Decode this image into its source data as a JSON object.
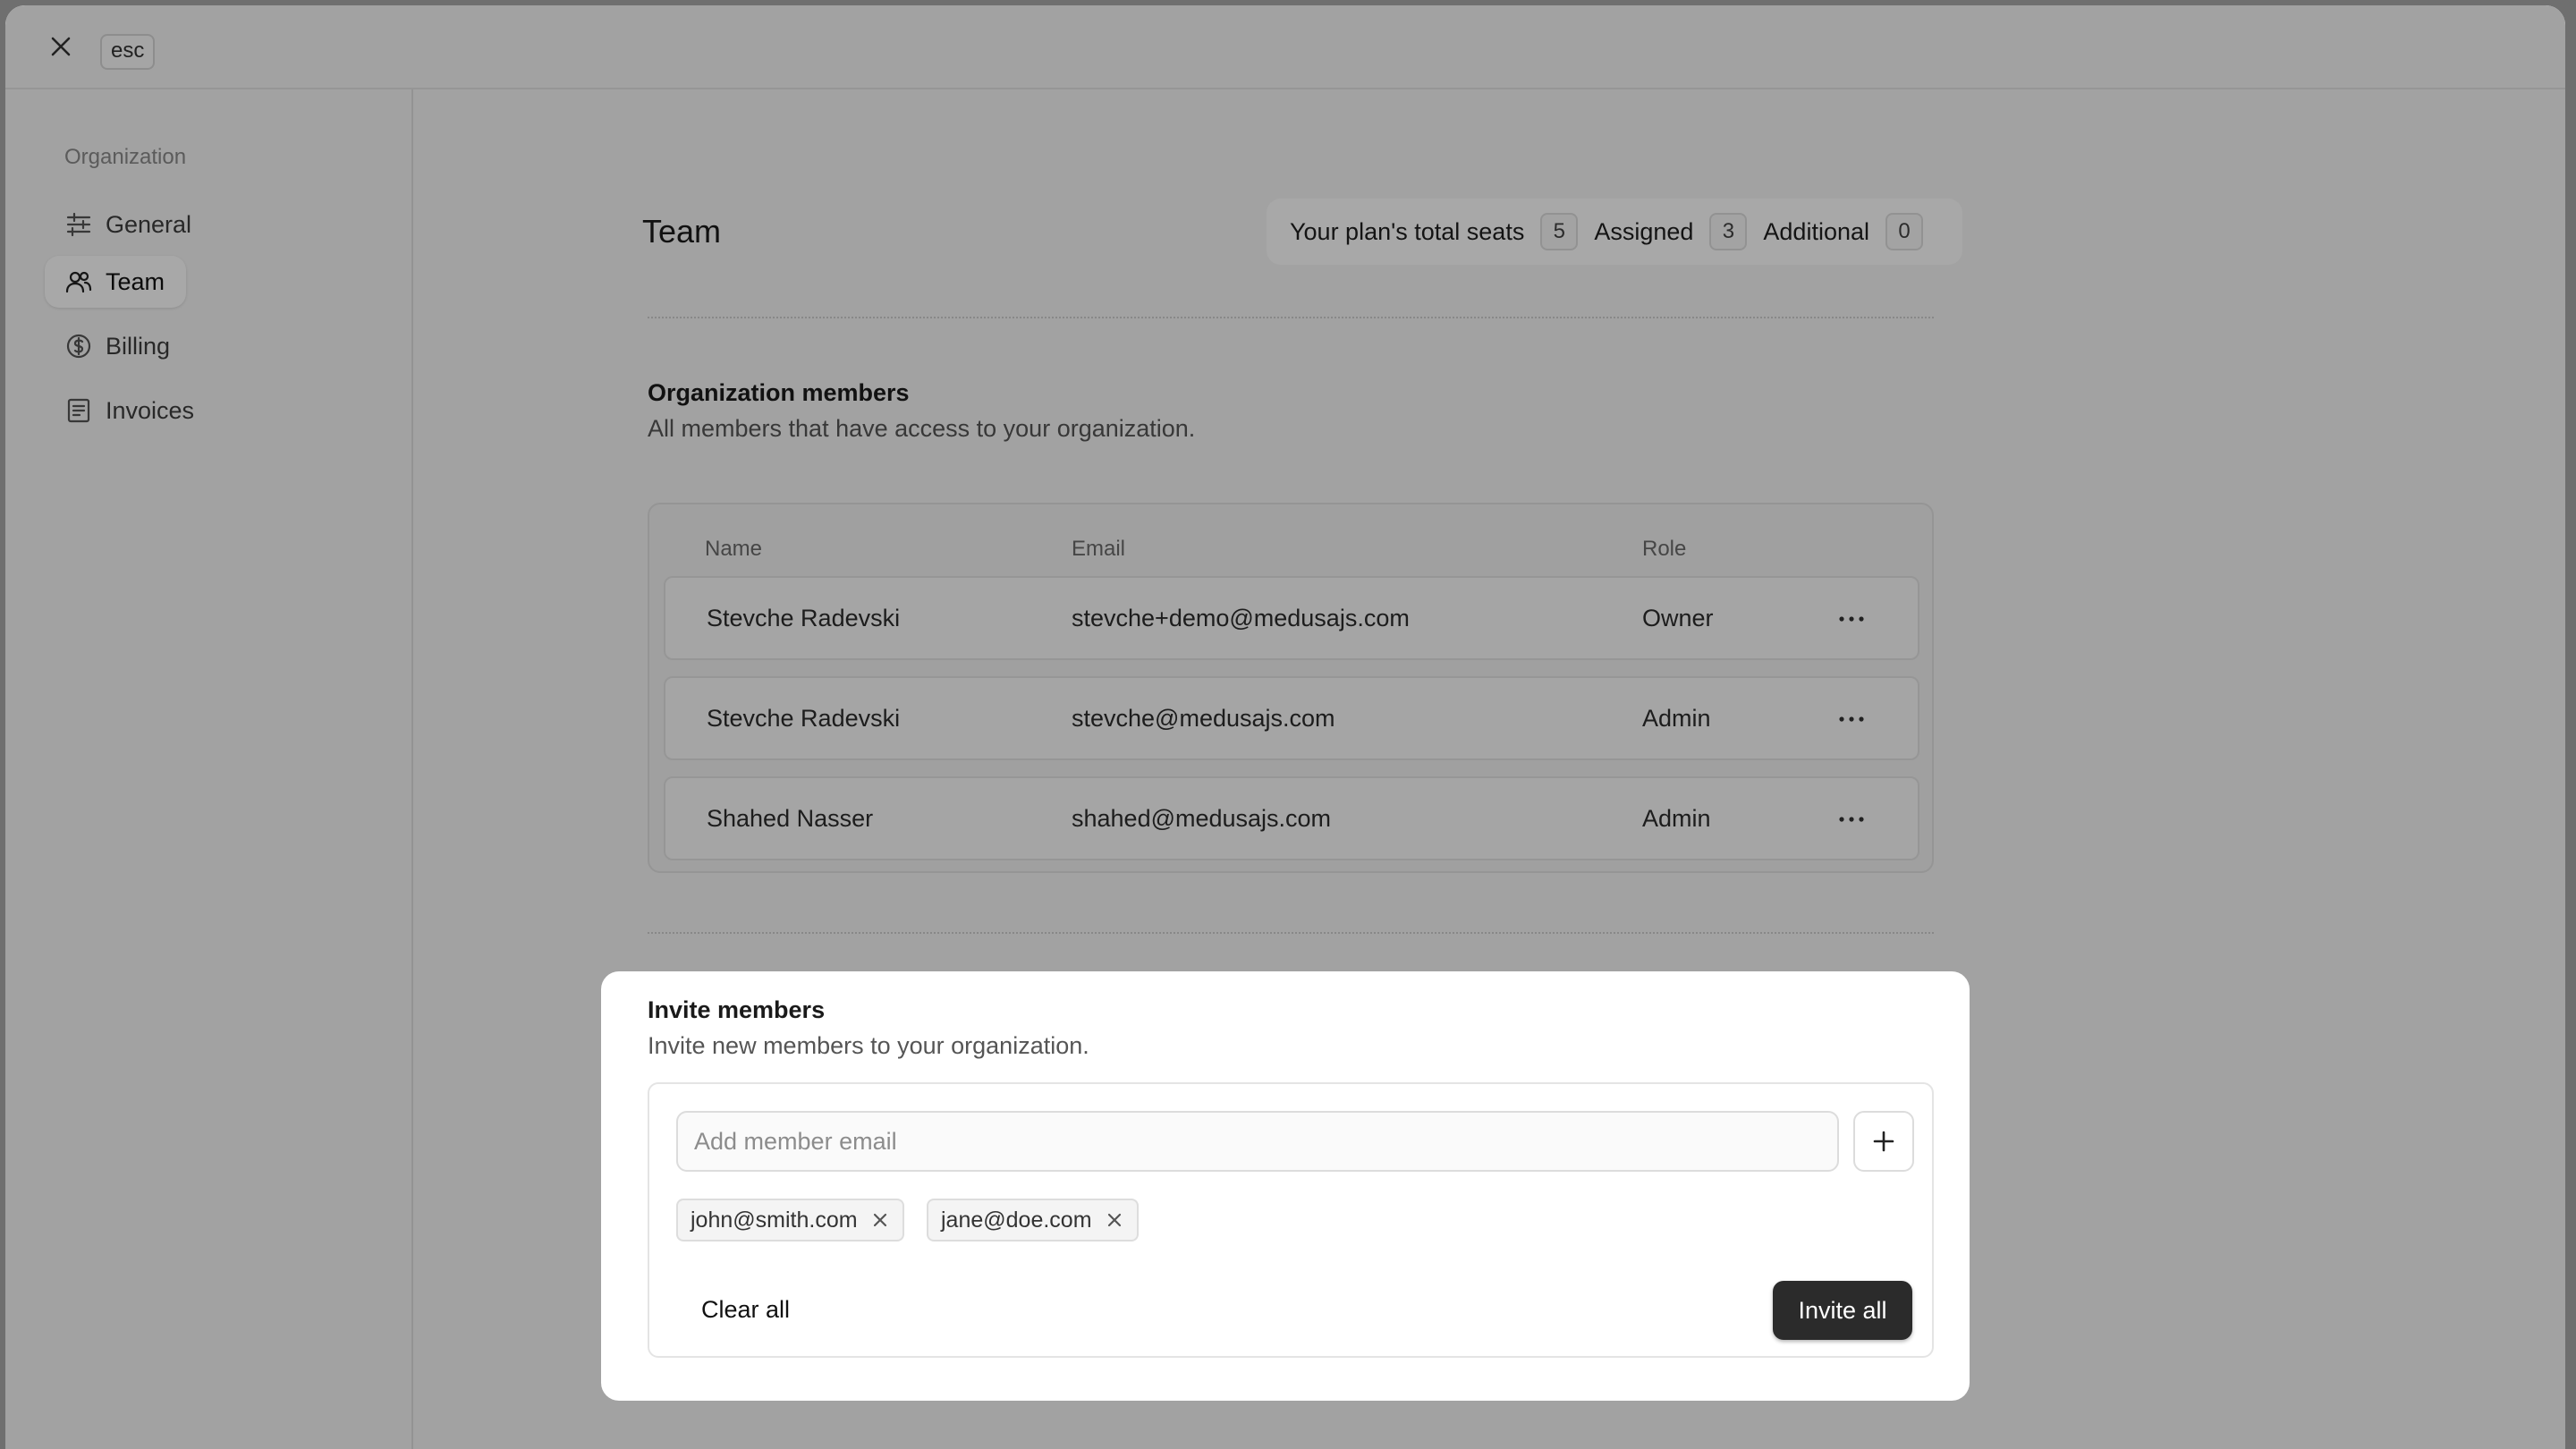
{
  "topbar": {
    "esc_label": "esc"
  },
  "sidebar": {
    "heading": "Organization",
    "items": [
      {
        "label": "General",
        "icon": "sliders-icon",
        "active": false
      },
      {
        "label": "Team",
        "icon": "users-icon",
        "active": true
      },
      {
        "label": "Billing",
        "icon": "dollar-circle-icon",
        "active": false
      },
      {
        "label": "Invoices",
        "icon": "receipt-icon",
        "active": false
      }
    ]
  },
  "main": {
    "title": "Team",
    "seats": {
      "total_label": "Your plan's total seats",
      "total_value": "5",
      "assigned_label": "Assigned",
      "assigned_value": "3",
      "additional_label": "Additional",
      "additional_value": "0"
    },
    "members": {
      "title": "Organization members",
      "subtitle": "All members that have access to your organization.",
      "columns": [
        "Name",
        "Email",
        "Role"
      ],
      "rows": [
        {
          "name": "Stevche Radevski",
          "email": "stevche+demo@medusajs.com",
          "role": "Owner"
        },
        {
          "name": "Stevche Radevski",
          "email": "stevche@medusajs.com",
          "role": "Admin"
        },
        {
          "name": "Shahed Nasser",
          "email": "shahed@medusajs.com",
          "role": "Admin"
        }
      ]
    }
  },
  "invite": {
    "title": "Invite members",
    "subtitle": "Invite new members to your organization.",
    "input_placeholder": "Add member email",
    "chips": [
      "john@smith.com",
      "jane@doe.com"
    ],
    "clear_label": "Clear all",
    "invite_label": "Invite all"
  },
  "colors": {
    "overlay": "#000000",
    "primary_button": "#2b2b2b",
    "card": "#ffffff"
  }
}
